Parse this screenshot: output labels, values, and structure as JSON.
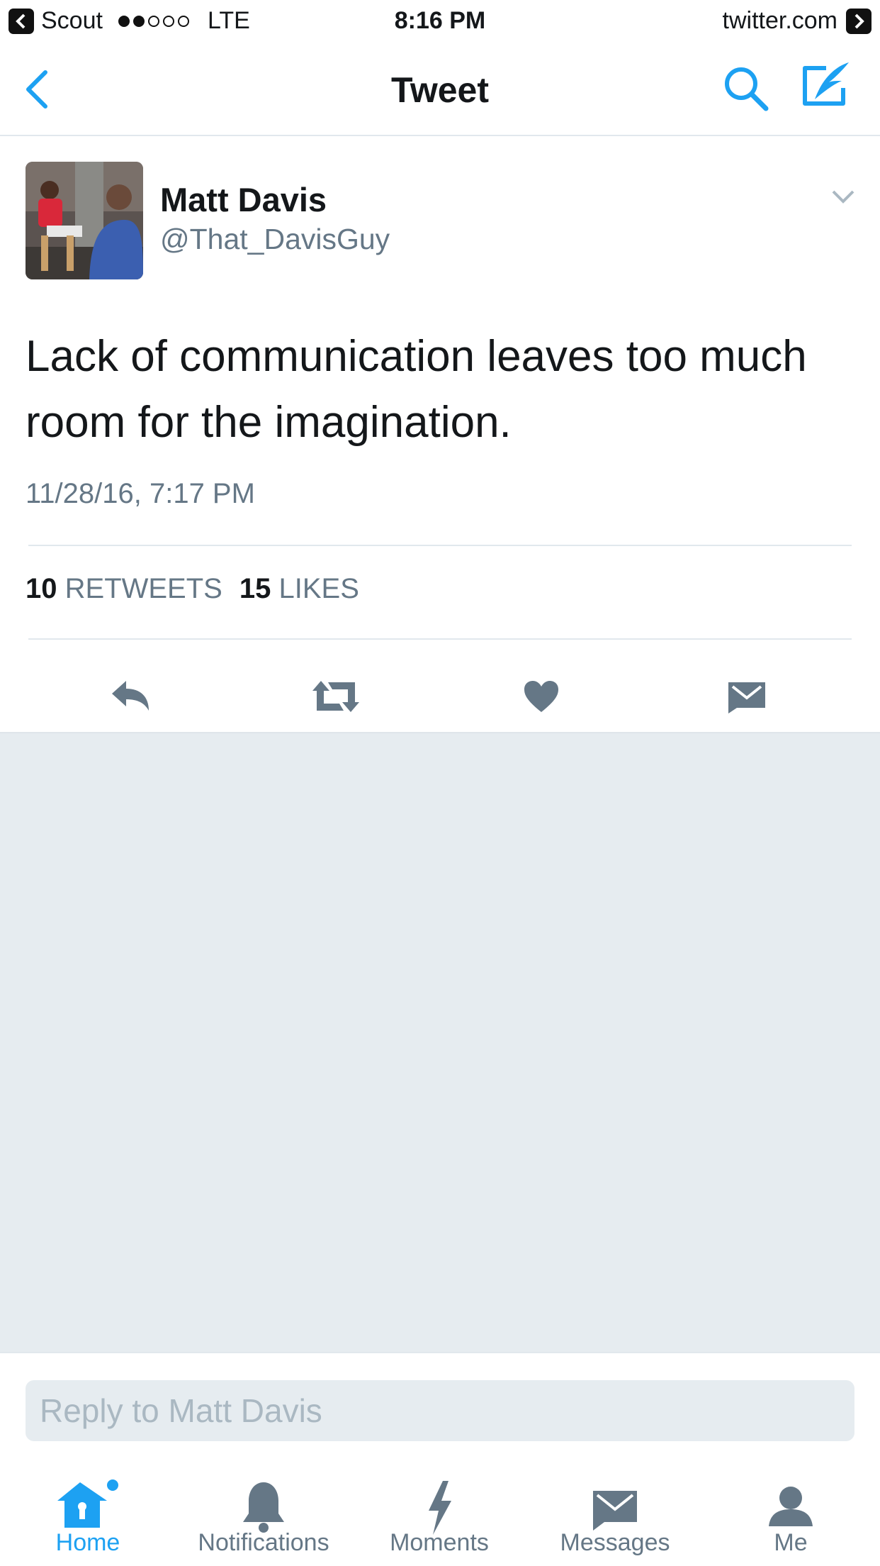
{
  "status_bar": {
    "back_app": "Scout",
    "network": "LTE",
    "time": "8:16 PM",
    "site": "twitter.com"
  },
  "nav": {
    "title": "Tweet"
  },
  "tweet": {
    "user_name": "Matt Davis",
    "handle": "@That_DavisGuy",
    "text": "Lack of communication leaves too much room for the imagination.",
    "timestamp": "11/28/16, 7:17 PM",
    "retweets_count": "10",
    "retweets_label": "RETWEETS",
    "likes_count": "15",
    "likes_label": "LIKES"
  },
  "reply": {
    "placeholder": "Reply to Matt Davis"
  },
  "tabs": [
    {
      "label": "Home",
      "icon": "home-icon",
      "active": true
    },
    {
      "label": "Notifications",
      "icon": "bell-icon",
      "active": false
    },
    {
      "label": "Moments",
      "icon": "lightning-icon",
      "active": false
    },
    {
      "label": "Messages",
      "icon": "envelope-icon",
      "active": false
    },
    {
      "label": "Me",
      "icon": "person-icon",
      "active": false
    }
  ],
  "colors": {
    "accent": "#1da1f2",
    "icon_gray": "#657786",
    "background_gray": "#e6ecf0"
  }
}
